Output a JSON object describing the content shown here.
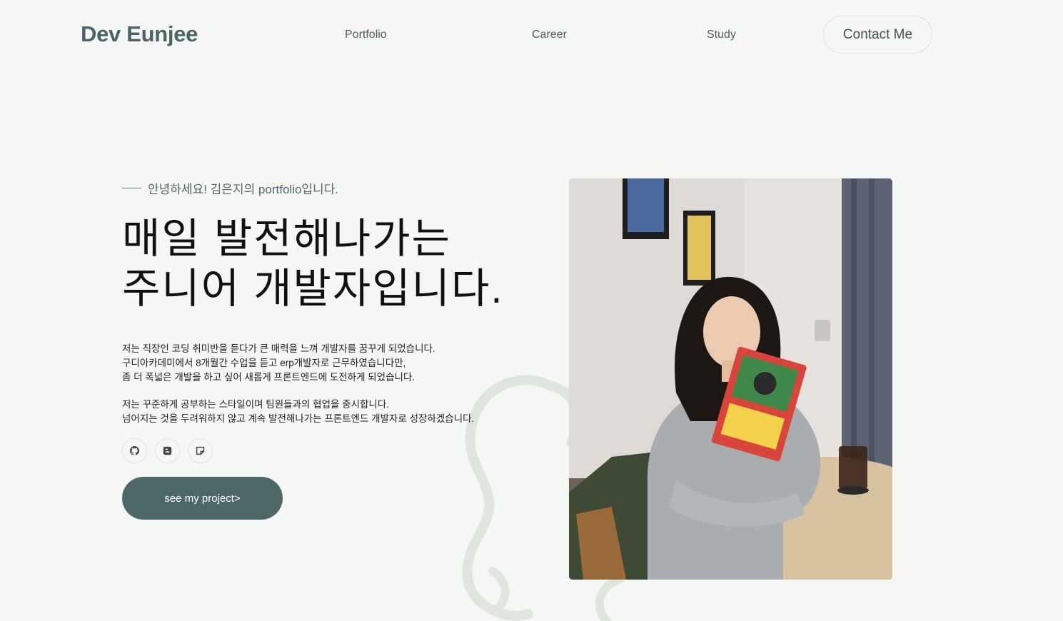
{
  "header": {
    "logo": "Dev Eunjee",
    "nav": {
      "portfolio": "Portfolio",
      "career": "Career",
      "study": "Study",
      "contact": "Contact Me"
    }
  },
  "hero": {
    "greeting": "안녕하세요! 김은지의 portfolio입니다.",
    "headline_line1": "매일 발전해나가는",
    "headline_line2": "주니어 개발자입니다.",
    "intro": [
      "저는 직장인 코딩 취미반을 듣다가 큰 매력을 느껴 개발자를 꿈꾸게 되었습니다.",
      "구디아카데미에서 8개월간 수업을 듣고 erp개발자로 근무하였습니다만,",
      "좀 더 폭넓은 개발을 하고 싶어 새롭게 프론트엔드에 도전하게 되었습니다.",
      "저는 꾸준하게 공부하는 스타일이며 팀원들과의 협업을 중시합니다.",
      "넘어지는 것을 두려워하지 않고 계속 발전해나가는 프론트엔드 개발자로 성장하겠습니다."
    ],
    "social_icons": [
      "github-icon",
      "blog-icon",
      "note-icon"
    ],
    "cta_label": "see my project>"
  },
  "colors": {
    "background": "#f5f7f4",
    "accent": "#4e6867",
    "logo": "#4b6564",
    "decoration": "#dfe6df"
  }
}
